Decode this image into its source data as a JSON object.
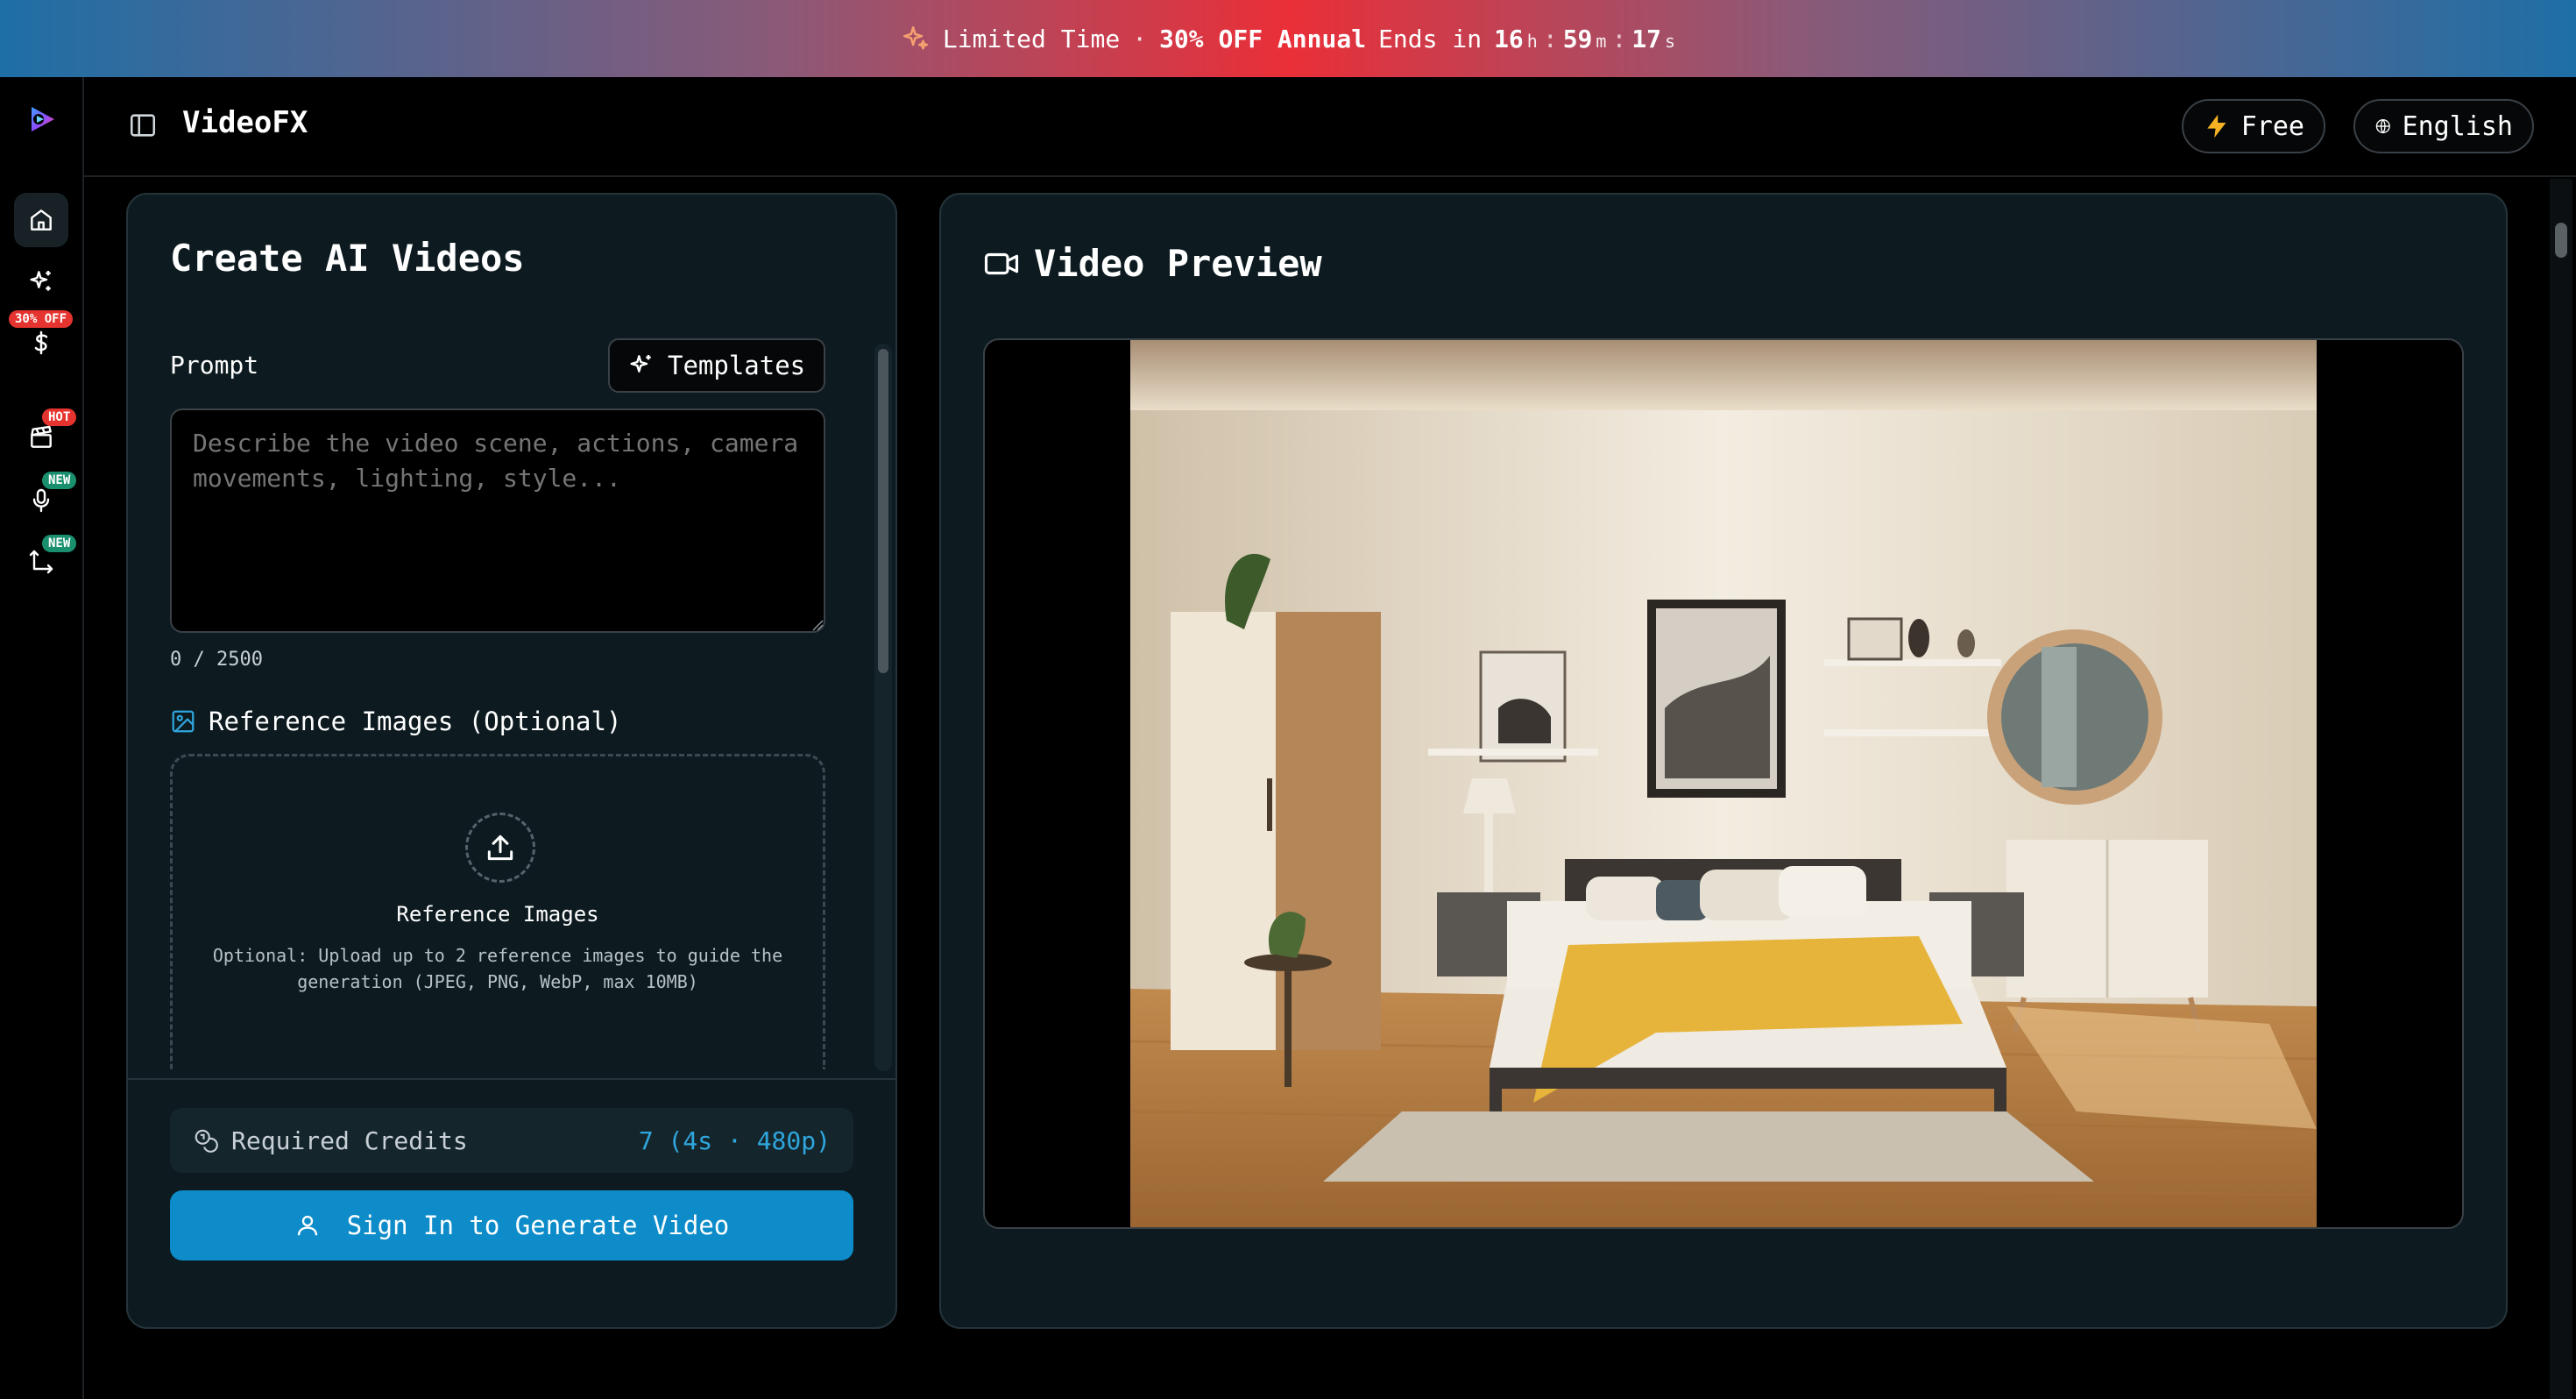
{
  "promo": {
    "prefix": "Limited Time",
    "separator": "·",
    "offer": "30% OFF Annual",
    "ends_in": "Ends in",
    "hours": "16",
    "hours_unit": "h",
    "minutes": "59",
    "minutes_unit": "m",
    "seconds": "17",
    "seconds_unit": "s",
    "colon": ":"
  },
  "sidebar": {
    "badges": {
      "pricing": "30% OFF",
      "templates": "HOT",
      "audio": "NEW",
      "convert": "NEW"
    }
  },
  "header": {
    "title": "VideoFX",
    "plan_label": "Free",
    "language_label": "English"
  },
  "create": {
    "title": "Create AI Videos",
    "prompt_label": "Prompt",
    "templates_label": "Templates",
    "prompt_value": "",
    "prompt_placeholder": "Describe the video scene, actions, camera movements, lighting, style...",
    "char_count": "0 / 2500",
    "reference_label": "Reference Images (Optional)",
    "dropzone_title": "Reference Images",
    "dropzone_desc": "Optional: Upload up to 2 reference images to guide the generation (JPEG, PNG, WebP, max 10MB)",
    "credits_label": "Required Credits",
    "credits_value": "7 (4s · 480p)",
    "sign_in_label": "Sign In to Generate Video"
  },
  "preview": {
    "title": "Video Preview"
  },
  "colors": {
    "accent": "#0d8cc9",
    "credits_text": "#2fa6dd",
    "card_bg": "#0d1b20",
    "promo_center": "#ea2f38",
    "promo_edge": "#1e6fa6"
  },
  "icons": {
    "promo": "sparkles-icon",
    "plan": "lightning-icon",
    "language": "globe-icon",
    "templates": "sparkles-icon",
    "reference": "image-icon",
    "upload": "upload-icon",
    "credits": "coins-icon",
    "sign_in": "user-icon",
    "preview": "video-camera-icon"
  }
}
